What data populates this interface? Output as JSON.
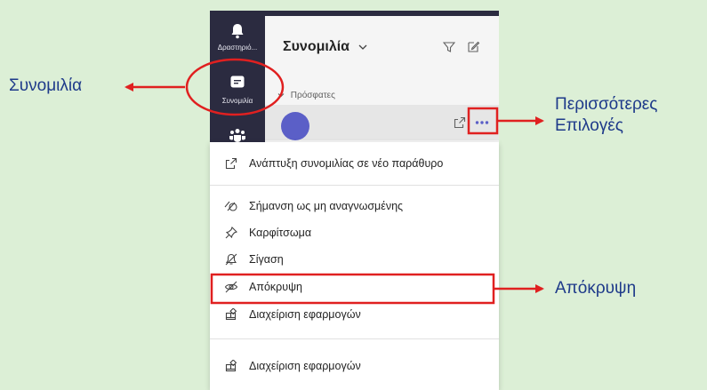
{
  "rail": {
    "activity_label": "Δραστηριό...",
    "chat_label": "Συνομιλία"
  },
  "chat_list": {
    "title": "Συνομιλία",
    "recent_label": "Πρόσφατες"
  },
  "context_menu": {
    "items": [
      {
        "label": "Ανάπτυξη συνομιλίας σε νέο παράθυρο",
        "icon": "popout-icon"
      },
      {
        "label": "Σήμανση ως μη αναγνωσμένης",
        "icon": "unread-icon"
      },
      {
        "label": "Καρφίτσωμα",
        "icon": "pin-icon"
      },
      {
        "label": "Σίγαση",
        "icon": "mute-icon"
      },
      {
        "label": "Απόκρυψη",
        "icon": "hide-icon"
      },
      {
        "label": "Διαχείριση εφαρμογών",
        "icon": "apps-icon"
      },
      {
        "label": "Διαχείριση εφαρμογών",
        "icon": "apps-icon"
      }
    ]
  },
  "annotations": {
    "chat": "Συνομιλία",
    "more_options_line1": "Περισσότερες",
    "more_options_line2": "Επιλογές",
    "hide": "Απόκρυψη"
  },
  "colors": {
    "background": "#dcefd6",
    "rail": "#2b2b40",
    "accent": "#5b5fc7",
    "annotation_text": "#1e3a8a",
    "annotation_red": "#e02020"
  }
}
